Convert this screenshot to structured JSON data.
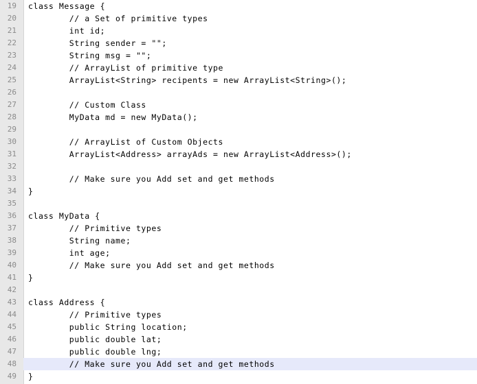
{
  "editor": {
    "lines": [
      {
        "number": "19",
        "code": "class Message {"
      },
      {
        "number": "20",
        "code": "        // a Set of primitive types"
      },
      {
        "number": "21",
        "code": "        int id;"
      },
      {
        "number": "22",
        "code": "        String sender = \"\";"
      },
      {
        "number": "23",
        "code": "        String msg = \"\";"
      },
      {
        "number": "24",
        "code": "        // ArrayList of primitive type"
      },
      {
        "number": "25",
        "code": "        ArrayList<String> recipents = new ArrayList<String>();"
      },
      {
        "number": "26",
        "code": ""
      },
      {
        "number": "27",
        "code": "        // Custom Class"
      },
      {
        "number": "28",
        "code": "        MyData md = new MyData();"
      },
      {
        "number": "29",
        "code": ""
      },
      {
        "number": "30",
        "code": "        // ArrayList of Custom Objects"
      },
      {
        "number": "31",
        "code": "        ArrayList<Address> arrayAds = new ArrayList<Address>();"
      },
      {
        "number": "32",
        "code": ""
      },
      {
        "number": "33",
        "code": "        // Make sure you Add set and get methods"
      },
      {
        "number": "34",
        "code": "}"
      },
      {
        "number": "35",
        "code": ""
      },
      {
        "number": "36",
        "code": "class MyData {"
      },
      {
        "number": "37",
        "code": "        // Primitive types"
      },
      {
        "number": "38",
        "code": "        String name;"
      },
      {
        "number": "39",
        "code": "        int age;"
      },
      {
        "number": "40",
        "code": "        // Make sure you Add set and get methods"
      },
      {
        "number": "41",
        "code": "}"
      },
      {
        "number": "42",
        "code": ""
      },
      {
        "number": "43",
        "code": "class Address {"
      },
      {
        "number": "44",
        "code": "        // Primitive types"
      },
      {
        "number": "45",
        "code": "        public String location;"
      },
      {
        "number": "46",
        "code": "        public double lat;"
      },
      {
        "number": "47",
        "code": "        public double lng;"
      },
      {
        "number": "48",
        "code": "        // Make sure you Add set and get methods",
        "highlighted": true
      },
      {
        "number": "49",
        "code": "}"
      }
    ]
  },
  "colors": {
    "gutter_background": "#e8e8e8",
    "line_number_text": "#8a8a8a",
    "code_text": "#000000",
    "current_line_highlight": "#e6e9fa",
    "editor_background": "#ffffff"
  }
}
